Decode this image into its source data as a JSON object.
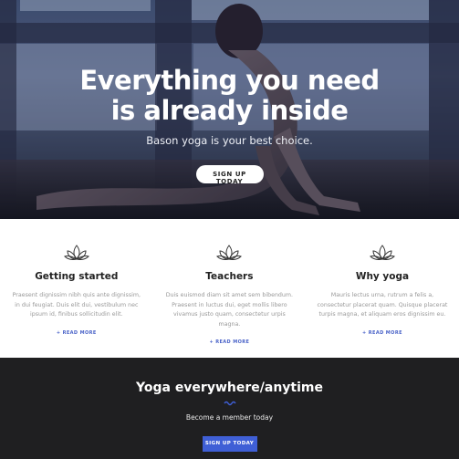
{
  "hero": {
    "title_line1": "Everything you need",
    "title_line2": "is already inside",
    "subtitle": "Bason yoga is your best choice.",
    "button_label": "SIGN UP TODAY"
  },
  "features": [
    {
      "icon": "lotus-icon",
      "title": "Getting started",
      "text": "Praesent dignissim nibh quis ante dignissim, in dui feugiat. Duis elit dui, vestibulum nec ipsum id, finibus sollicitudin elit.",
      "link": "READ MORE"
    },
    {
      "icon": "lotus-icon",
      "title": "Teachers",
      "text": "Duis euismod diam sit amet sem bibendum. Praesent in luctus dui, eget mollis libero vivamus justo quam, consectetur urpis magna.",
      "link": "READ MORE"
    },
    {
      "icon": "lotus-icon",
      "title": "Why yoga",
      "text": "Mauris lectus urna, rutrum a felis a, consectetur placerat quam. Quisque placerat turpis magna, et aliquam eros dignissim eu.",
      "link": "READ MORE"
    }
  ],
  "cta": {
    "title": "Yoga everywhere/anytime",
    "subtitle": "Become a member today",
    "button_label": "SIGN UP TODAY"
  },
  "colors": {
    "accent": "#3f5fd6",
    "dark_section": "#1f1f21",
    "link": "#4a63c8"
  }
}
